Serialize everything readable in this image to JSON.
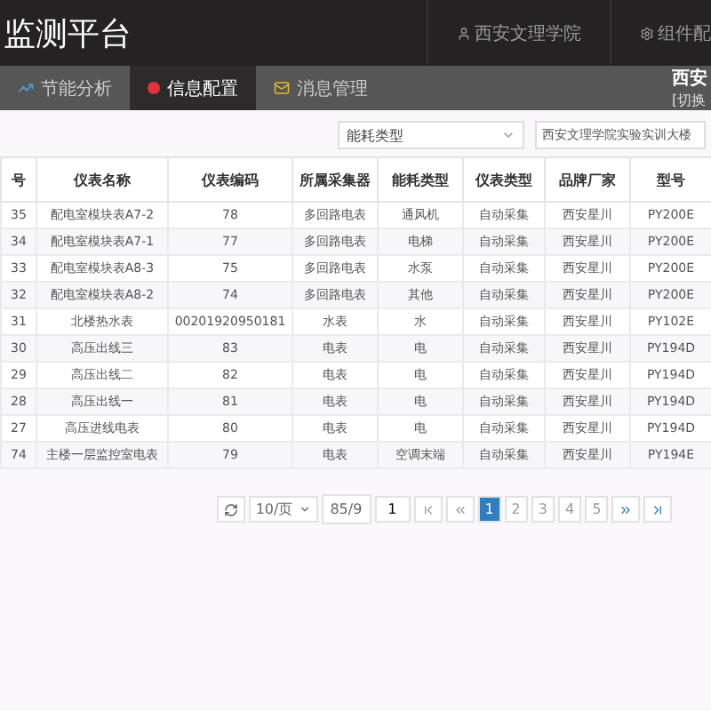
{
  "header": {
    "title": "监测平台",
    "user": "西安文理学院",
    "settings": "组件配"
  },
  "nav": {
    "tabs": [
      {
        "label": "节能分析",
        "selected": false
      },
      {
        "label": "信息配置",
        "selected": true
      },
      {
        "label": "消息管理",
        "selected": false
      }
    ],
    "site": "西安",
    "switch": "[切换"
  },
  "filters": {
    "select": "能耗类型",
    "building": "西安文理学院实验实训大楼"
  },
  "table": {
    "columns": [
      "号",
      "仪表名称",
      "仪表编码",
      "所属采集器",
      "能耗类型",
      "仪表类型",
      "品牌厂家",
      "型号"
    ],
    "rows": [
      [
        "35",
        "配电室模块表A7-2",
        "78",
        "多回路电表",
        "通风机",
        "自动采集",
        "西安星川",
        "PY200E"
      ],
      [
        "34",
        "配电室模块表A7-1",
        "77",
        "多回路电表",
        "电梯",
        "自动采集",
        "西安星川",
        "PY200E"
      ],
      [
        "33",
        "配电室模块表A8-3",
        "75",
        "多回路电表",
        "水泵",
        "自动采集",
        "西安星川",
        "PY200E"
      ],
      [
        "32",
        "配电室模块表A8-2",
        "74",
        "多回路电表",
        "其他",
        "自动采集",
        "西安星川",
        "PY200E"
      ],
      [
        "31",
        "北楼热水表",
        "00201920950181",
        "水表",
        "水",
        "自动采集",
        "西安星川",
        "PY102E"
      ],
      [
        "30",
        "高压出线三",
        "83",
        "电表",
        "电",
        "自动采集",
        "西安星川",
        "PY194D"
      ],
      [
        "29",
        "高压出线二",
        "82",
        "电表",
        "电",
        "自动采集",
        "西安星川",
        "PY194D"
      ],
      [
        "28",
        "高压出线一",
        "81",
        "电表",
        "电",
        "自动采集",
        "西安星川",
        "PY194D"
      ],
      [
        "27",
        "高压进线电表",
        "80",
        "电表",
        "电",
        "自动采集",
        "西安星川",
        "PY194D"
      ],
      [
        "74",
        "主楼一层监控室电表",
        "79",
        "电表",
        "空调末端",
        "自动采集",
        "西安星川",
        "PY194E"
      ]
    ]
  },
  "pagination": {
    "page_size": "10/页",
    "total": "85/9",
    "page_input": "1",
    "pages": [
      {
        "label": "1",
        "selected": true
      },
      {
        "label": "2",
        "selected": false
      },
      {
        "label": "3",
        "selected": false
      },
      {
        "label": "4",
        "selected": false
      },
      {
        "label": "5",
        "selected": false
      }
    ]
  }
}
